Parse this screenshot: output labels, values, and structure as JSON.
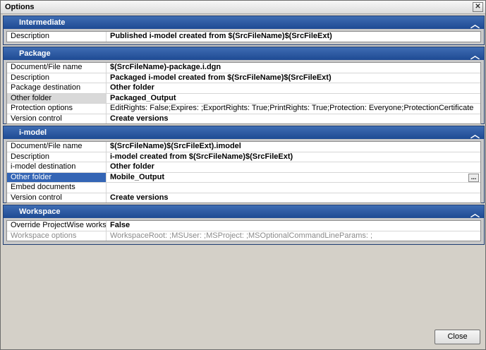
{
  "window": {
    "title": "Options"
  },
  "sections": {
    "intermediate": {
      "header": "Intermediate",
      "rows": [
        {
          "name": "Description",
          "value": "Published i-model created from $(SrcFileName)$(SrcFileExt)"
        }
      ]
    },
    "package": {
      "header": "Package",
      "rows": [
        {
          "name": "Document/File name",
          "value": "$(SrcFileName)-package.i.dgn"
        },
        {
          "name": "Description",
          "value": "Packaged i-model created from $(SrcFileName)$(SrcFileExt)"
        },
        {
          "name": "Package destination",
          "value": "Other folder"
        },
        {
          "name": "Other folder",
          "value": "Packaged_Output"
        },
        {
          "name": "Protection options",
          "value": "EditRights: False;Expires: ;ExportRights: True;PrintRights: True;Protection: Everyone;ProtectionCertificate"
        },
        {
          "name": "Version control",
          "value": "Create versions"
        }
      ]
    },
    "imodel": {
      "header": "i-model",
      "rows": [
        {
          "name": "Document/File name",
          "value": "$(SrcFileName)$(SrcFileExt).imodel"
        },
        {
          "name": "Description",
          "value": "i-model created from $(SrcFileName)$(SrcFileExt)"
        },
        {
          "name": "i-model destination",
          "value": "Other folder"
        },
        {
          "name": "Other folder",
          "value": "Mobile_Output"
        },
        {
          "name": "Embed documents",
          "value": ""
        },
        {
          "name": "Version control",
          "value": "Create versions"
        }
      ]
    },
    "workspace": {
      "header": "Workspace",
      "rows": [
        {
          "name": "Override ProjectWise workspace",
          "value": "False"
        },
        {
          "name": "Workspace options",
          "value": "WorkspaceRoot: ;MSUser: ;MSProject: ;MSOptionalCommandLineParams: ;"
        }
      ]
    }
  },
  "buttons": {
    "close": "Close",
    "ellipsis": "..."
  },
  "icons": {
    "collapse": "chevron-up-icon",
    "window_close": "close-icon"
  }
}
